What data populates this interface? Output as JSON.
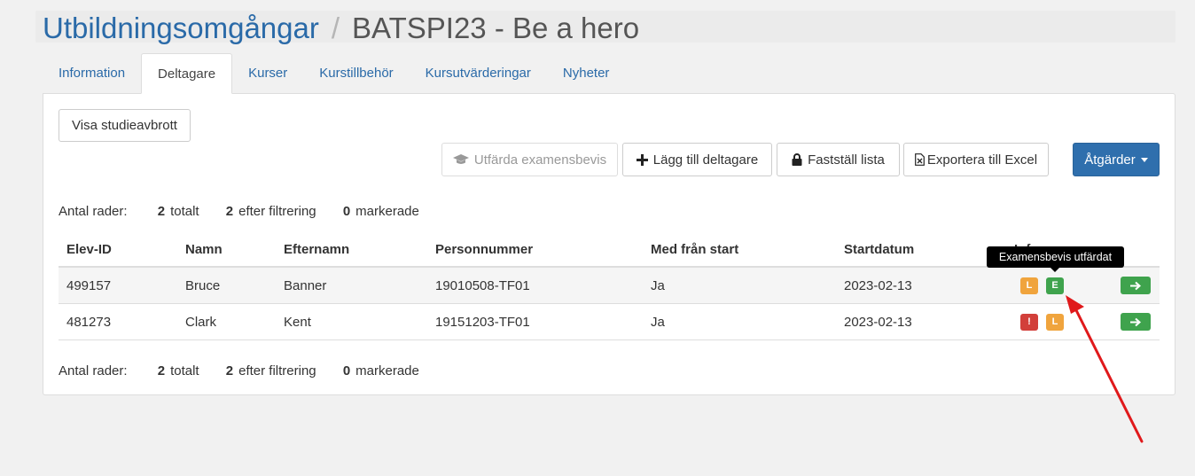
{
  "breadcrumb": {
    "parent": "Utbildningsomgångar",
    "separator": "/",
    "current": "BATSPI23 - Be a hero"
  },
  "tabs": [
    {
      "label": "Information",
      "active": false
    },
    {
      "label": "Deltagare",
      "active": true
    },
    {
      "label": "Kurser",
      "active": false
    },
    {
      "label": "Kurstillbehör",
      "active": false
    },
    {
      "label": "Kursutvärderingar",
      "active": false
    },
    {
      "label": "Nyheter",
      "active": false
    }
  ],
  "toolbar": {
    "show_dropouts": "Visa studieavbrott",
    "issue_diplomas": "Utfärda examensbevis",
    "add_participant": "Lägg till deltagare",
    "lock_list": "Fastställ lista",
    "export_excel": "Exportera till Excel",
    "actions": "Åtgärder"
  },
  "counts": {
    "label": "Antal rader:",
    "total": "2",
    "total_label": "totalt",
    "filtered": "2",
    "filtered_label": "efter filtrering",
    "selected": "0",
    "selected_label": "markerade"
  },
  "table": {
    "columns": [
      "Elev-ID",
      "Namn",
      "Efternamn",
      "Personnummer",
      "Med från start",
      "Startdatum",
      "Info"
    ],
    "rows": [
      {
        "id": "499157",
        "first": "Bruce",
        "last": "Banner",
        "pnr": "19010508-TF01",
        "from_start": "Ja",
        "start": "2023-02-13",
        "badges": [
          {
            "text": "L",
            "color": "#f0a43d"
          },
          {
            "text": "E",
            "color": "#3fa34d"
          }
        ]
      },
      {
        "id": "481273",
        "first": "Clark",
        "last": "Kent",
        "pnr": "19151203-TF01",
        "from_start": "Ja",
        "start": "2023-02-13",
        "badges": [
          {
            "text": "!",
            "color": "#d23f3a"
          },
          {
            "text": "L",
            "color": "#f0a43d"
          }
        ]
      }
    ]
  },
  "tooltip": "Examensbevis utfärdat",
  "colors": {
    "link": "#2a6aa8",
    "primary": "#2f6fad",
    "success": "#3fa34d",
    "warning": "#f0a43d",
    "danger": "#d23f3a",
    "annotation_arrow": "#e0191b"
  }
}
